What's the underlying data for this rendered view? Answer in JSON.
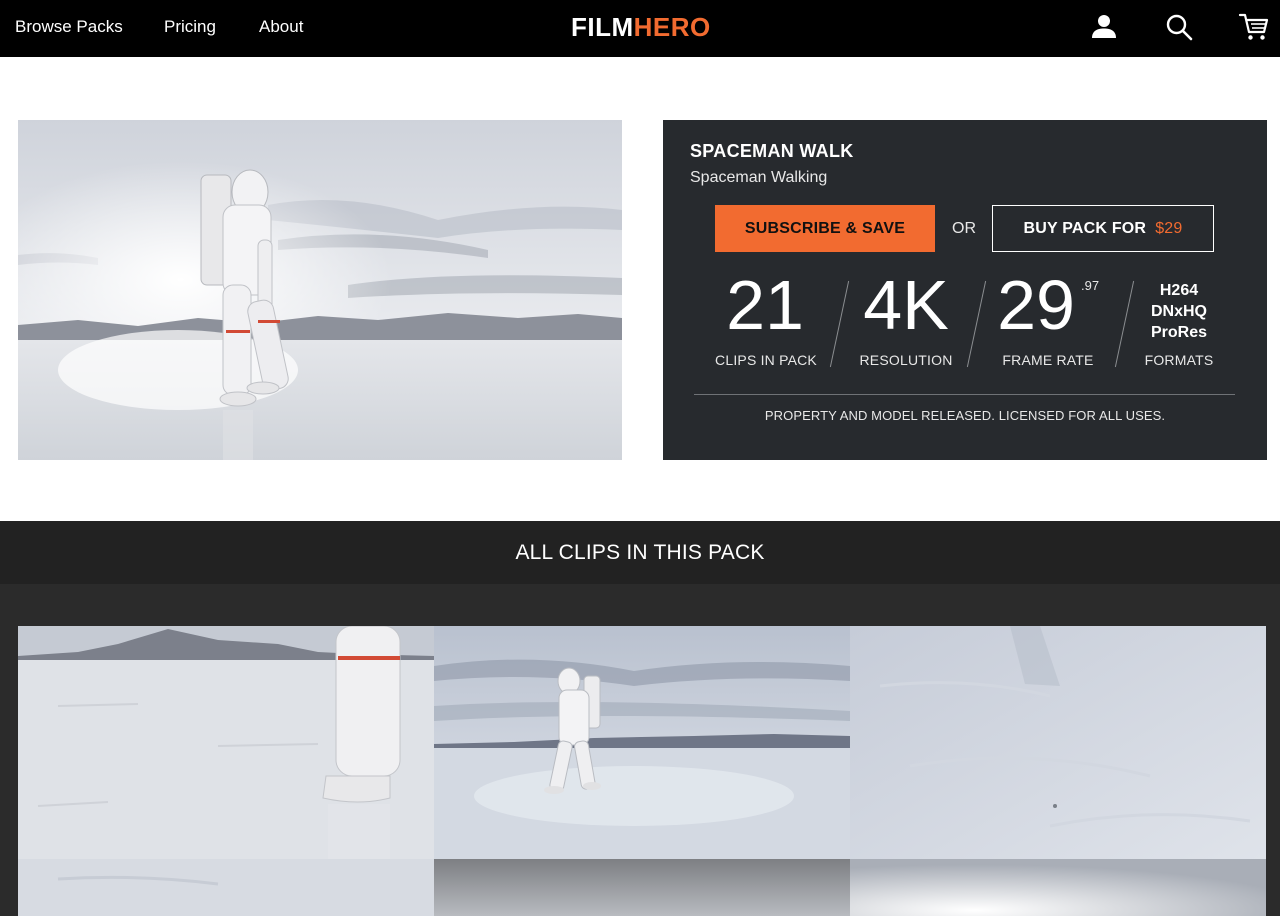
{
  "nav": {
    "links": [
      "Browse Packs",
      "Pricing",
      "About"
    ],
    "logo_part1": "FILM",
    "logo_part2": "HERO",
    "icons": [
      "user-icon",
      "search-icon",
      "cart-icon"
    ]
  },
  "pack": {
    "title": "SPACEMAN WALK",
    "subtitle": "Spaceman Walking",
    "subscribe_label": "SUBSCRIBE & SAVE",
    "or_label": "OR",
    "buy_label": "BUY PACK FOR",
    "buy_price": "$29",
    "stats": {
      "clips_value": "21",
      "clips_label": "CLIPS IN PACK",
      "resolution_value": "4K",
      "resolution_label": "RESOLUTION",
      "frame_rate_value": "29",
      "frame_rate_sup": ".97",
      "frame_rate_label": "FRAME RATE",
      "formats": [
        "H264",
        "DNxHQ",
        "ProRes"
      ],
      "formats_label": "FORMATS"
    },
    "license": "PROPERTY AND MODEL RELEASED. LICENSED FOR ALL USES."
  },
  "clips": {
    "heading": "ALL CLIPS IN THIS PACK"
  },
  "colors": {
    "accent": "#f26b30",
    "panel": "#272a2e",
    "nav": "#000000"
  }
}
